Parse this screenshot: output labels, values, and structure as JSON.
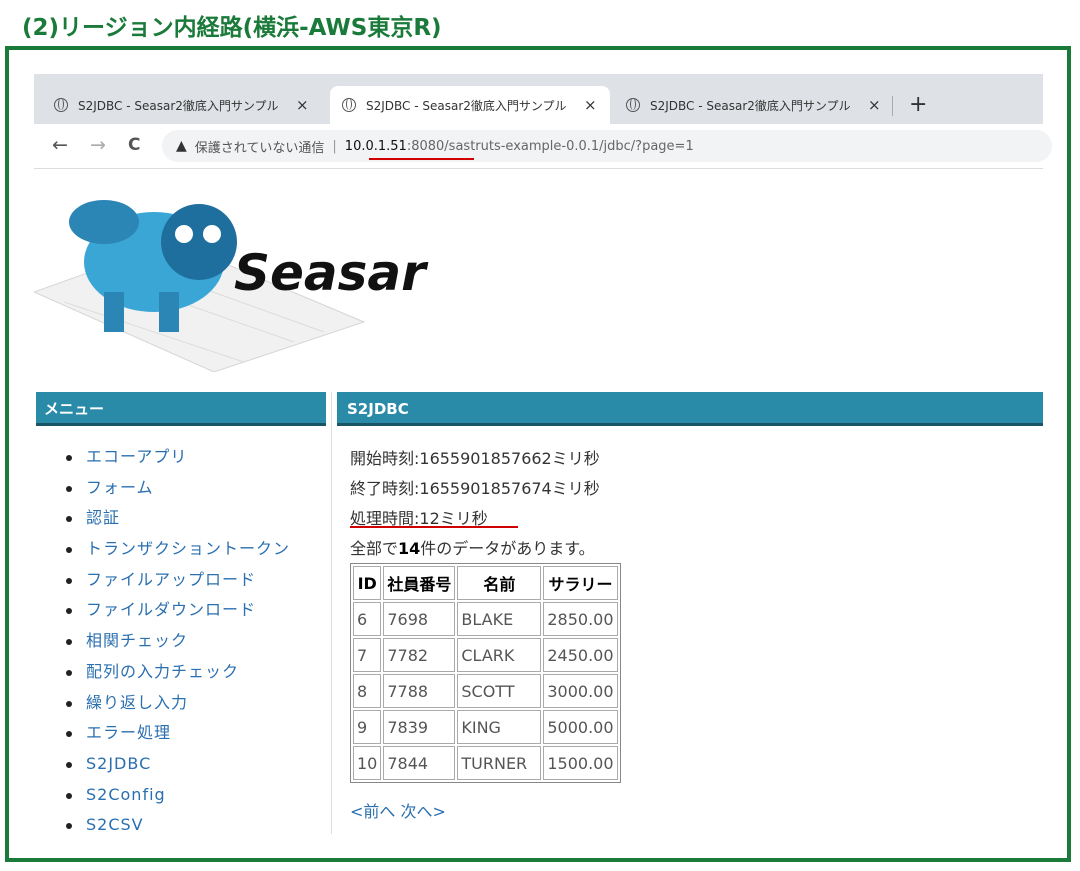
{
  "slide": {
    "title": "(2)リージョン内経路(横浜-AWS東京R)"
  },
  "browser": {
    "tabs": [
      {
        "title": "S2JDBC - Seasar2徹底入門サンプル",
        "close": "×"
      },
      {
        "title": "S2JDBC - Seasar2徹底入門サンプル",
        "close": "×"
      },
      {
        "title": "S2JDBC - Seasar2徹底入門サンプル",
        "close": "×"
      }
    ],
    "new_tab": "+",
    "nav": {
      "back": "←",
      "forward": "→",
      "reload": "C"
    },
    "warning_icon": "▲",
    "insecure_label": "保護されていない通信",
    "separator": "|",
    "url": {
      "host": "10.0.1.51",
      "port": ":8080",
      "path": "/sastruts-example-0.0.1/jdbc/?page=1"
    }
  },
  "logo": {
    "text": "Seasar"
  },
  "menu": {
    "header": "メニュー",
    "items": [
      "エコーアプリ",
      "フォーム",
      "認証",
      "トランザクショントークン",
      "ファイルアップロード",
      "ファイルダウンロード",
      "相関チェック",
      "配列の入力チェック",
      "繰り返し入力",
      "エラー処理",
      "S2JDBC",
      "S2Config",
      "S2CSV"
    ]
  },
  "main": {
    "header": "S2JDBC",
    "start": "開始時刻:1655901857662ミリ秒",
    "end": "終了時刻:1655901857674ミリ秒",
    "elapsed": "処理時間:12ミリ秒",
    "total_prefix": "全部で",
    "total_count": "14",
    "total_suffix": "件のデータがあります。",
    "table": {
      "headers": [
        "ID",
        "社員番号",
        "名前",
        "サラリー"
      ],
      "rows": [
        [
          "6",
          "7698",
          "BLAKE",
          "2850.00"
        ],
        [
          "7",
          "7782",
          "CLARK",
          "2450.00"
        ],
        [
          "8",
          "7788",
          "SCOTT",
          "3000.00"
        ],
        [
          "9",
          "7839",
          "KING",
          "5000.00"
        ],
        [
          "10",
          "7844",
          "TURNER",
          "1500.00"
        ]
      ]
    },
    "pager": "<前へ 次へ>"
  },
  "colors": {
    "frame": "#1a7a3a",
    "header_bar": "#2a8ba8",
    "underline": "#d00000",
    "link": "#2a6fb0"
  }
}
